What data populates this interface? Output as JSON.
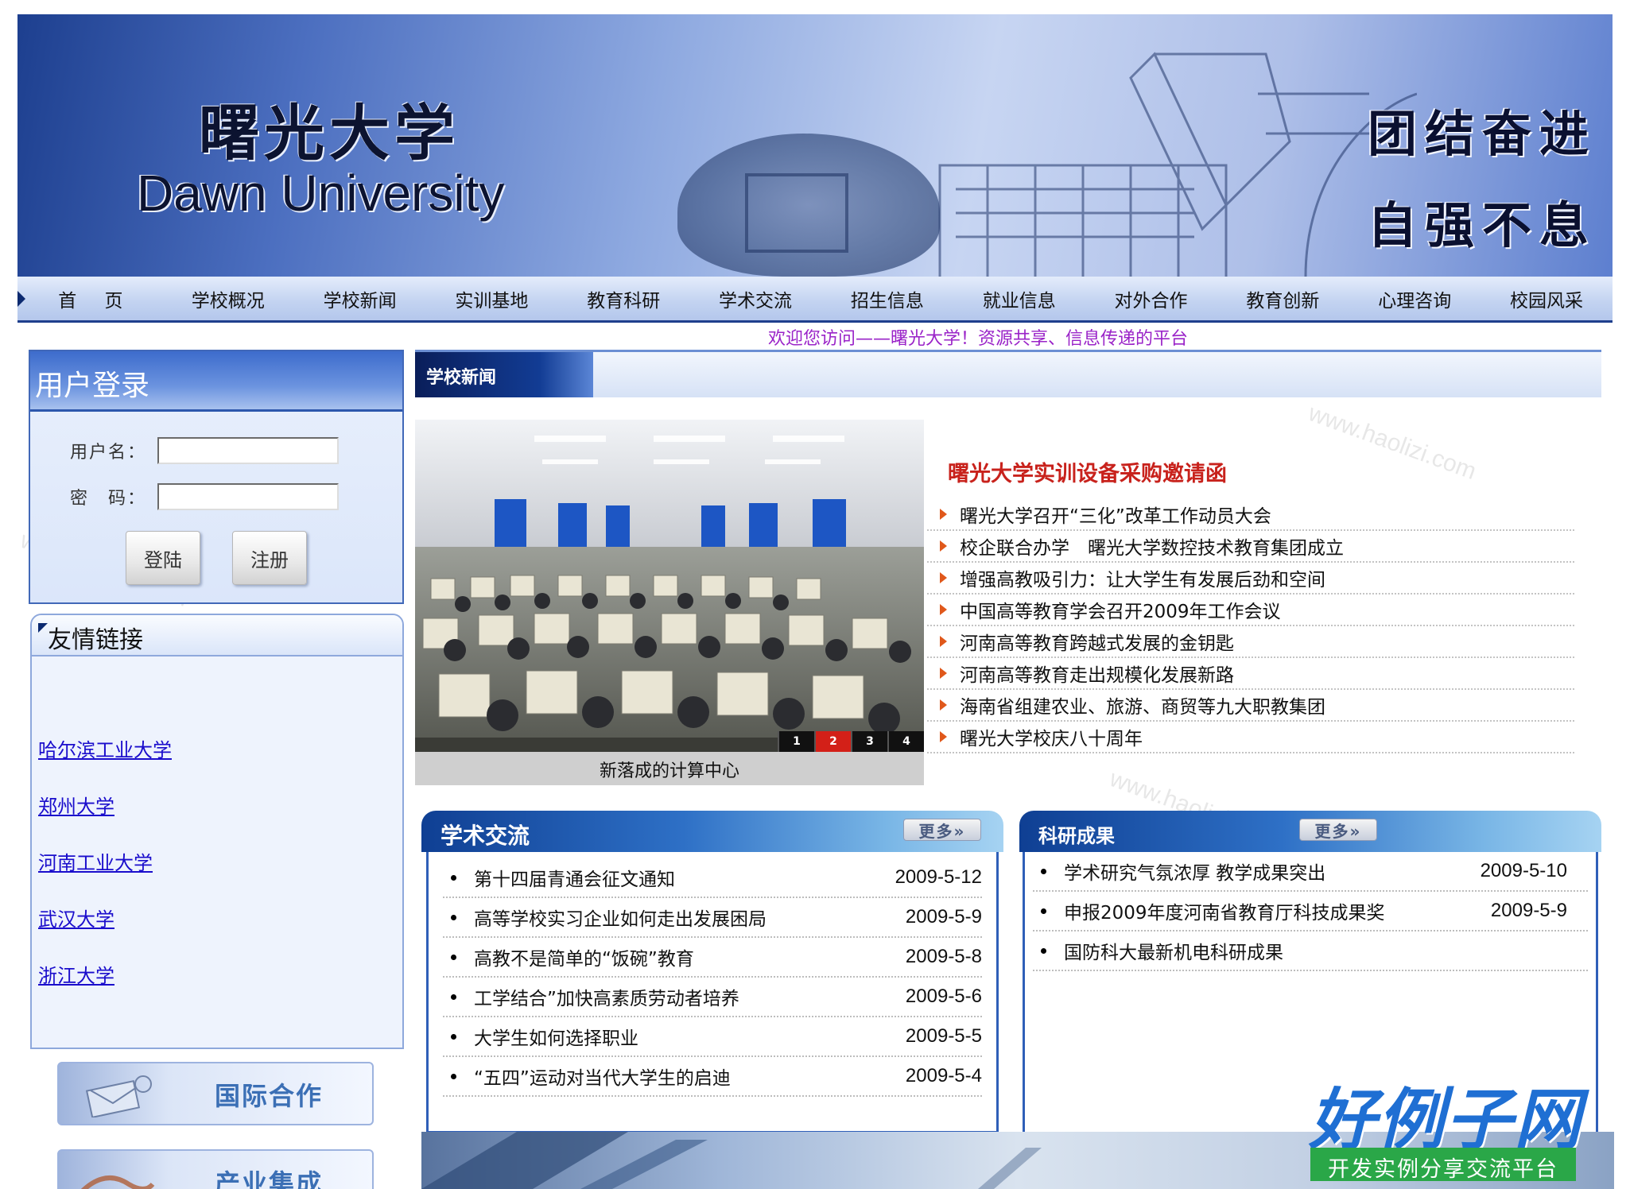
{
  "banner": {
    "title_cn": "曙光大学",
    "title_en": "Dawn University",
    "motto_line1": "团结奋进",
    "motto_line2": "自强不息"
  },
  "nav": {
    "items": [
      "首 页",
      "学校概况",
      "学校新闻",
      "实训基地",
      "教育科研",
      "学术交流",
      "招生信息",
      "就业信息",
      "对外合作",
      "教育创新",
      "心理咨询",
      "校园风采"
    ]
  },
  "welcome": "欢迎您访问——曙光大学！资源共享、信息传递的平台",
  "login": {
    "title": "用户登录",
    "username_label": "用户名：",
    "password_label": "密　码：",
    "login_button": "登陆",
    "register_button": "注册"
  },
  "links": {
    "title": "友情链接",
    "items": [
      "哈尔滨工业大学",
      "郑州大学",
      "河南工业大学",
      "武汉大学",
      "浙江大学"
    ]
  },
  "promos": [
    "国际合作",
    "产业集成"
  ],
  "school_news": {
    "tab": "学校新闻",
    "photo_caption": "新落成的计算中心",
    "pager": [
      "1",
      "2",
      "3",
      "4"
    ],
    "pager_active": 2,
    "headline": "曙光大学实训设备采购邀请函",
    "items": [
      "曙光大学召开“三化”改革工作动员大会",
      "校企联合办学　曙光大学数控技术教育集团成立",
      "增强高教吸引力：让大学生有发展后劲和空间",
      "中国高等教育学会召开2009年工作会议",
      "河南高等教育跨越式发展的金钥匙",
      "河南高等教育走出规模化发展新路",
      "海南省组建农业、旅游、商贸等九大职教集团",
      "曙光大学校庆八十周年"
    ]
  },
  "academic": {
    "title": "学术交流",
    "more": "更多»",
    "items": [
      {
        "title": "第十四届青通会征文通知",
        "date": "2009-5-12"
      },
      {
        "title": "高等学校实习企业如何走出发展困局",
        "date": "2009-5-9"
      },
      {
        "title": "高教不是简单的“饭碗”教育",
        "date": "2009-5-8"
      },
      {
        "title": "工学结合”加快高素质劳动者培养",
        "date": "2009-5-6"
      },
      {
        "title": "大学生如何选择职业",
        "date": "2009-5-5"
      },
      {
        "title": "“五四”运动对当代大学生的启迪",
        "date": "2009-5-4"
      }
    ]
  },
  "research": {
    "title": "科研成果",
    "more": "更多»",
    "items": [
      {
        "title": "学术研究气氛浓厚 教学成果突出",
        "date": "2009-5-10"
      },
      {
        "title": "申报2009年度河南省教育厅科技成果奖",
        "date": "2009-5-9"
      },
      {
        "title": "国防科大最新机电科研成果",
        "date": ""
      }
    ]
  },
  "logo": {
    "name": "好例子网",
    "tagline": "开发实例分享交流平台"
  },
  "watermark": "www.haolizi.com",
  "colors": {
    "nav_border": "#1f3f8c",
    "headline_red": "#c8221c",
    "welcome_purple": "#9a23c8",
    "link_blue": "#1a0dcc",
    "logo_green": "#2aa748"
  }
}
